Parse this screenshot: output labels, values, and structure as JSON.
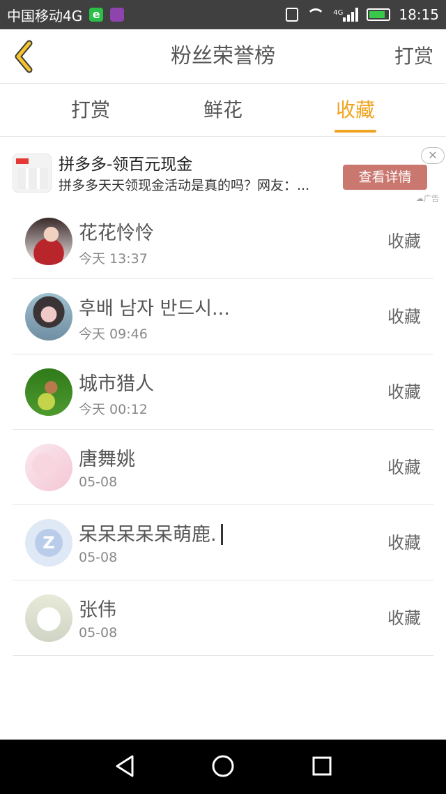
{
  "status_bar": {
    "carrier": "中国移动4G",
    "network_badge": "4G",
    "time": "18:15",
    "icons": [
      "browser-e-icon",
      "gallery-icon",
      "vibrate-icon",
      "wifi-icon",
      "signal-icon",
      "battery-charging-icon"
    ]
  },
  "header": {
    "back_icon": "chevron-left-icon",
    "title": "粉丝荣誉榜",
    "action_label": "打赏"
  },
  "tabs": [
    {
      "label": "打赏",
      "active": false
    },
    {
      "label": "鲜花",
      "active": false
    },
    {
      "label": "收藏",
      "active": true
    }
  ],
  "accent_color": "#f0a31e",
  "ad": {
    "title": "拼多多-领百元现金",
    "description": "拼多多天天领现金活动是真的吗？网友：...",
    "button_label": "查看详情",
    "close_icon": "close-icon",
    "tag": "广告",
    "button_color": "#c9776f"
  },
  "list": [
    {
      "name": "花花怜怜",
      "time": "今天 13:37",
      "action": "收藏"
    },
    {
      "name": "후배 남자 반드시...",
      "time": "今天 09:46",
      "action": "收藏"
    },
    {
      "name": "城市猎人",
      "time": "今天 00:12",
      "action": "收藏"
    },
    {
      "name": "唐舞姚",
      "time": "05-08",
      "action": "收藏"
    },
    {
      "name": "呆呆呆呆呆萌鹿.",
      "time": "05-08",
      "action": "收藏"
    },
    {
      "name": "张伟",
      "time": "05-08",
      "action": "收藏"
    }
  ],
  "nav_bar": {
    "icons": [
      "nav-back-icon",
      "nav-home-icon",
      "nav-recent-icon"
    ]
  }
}
